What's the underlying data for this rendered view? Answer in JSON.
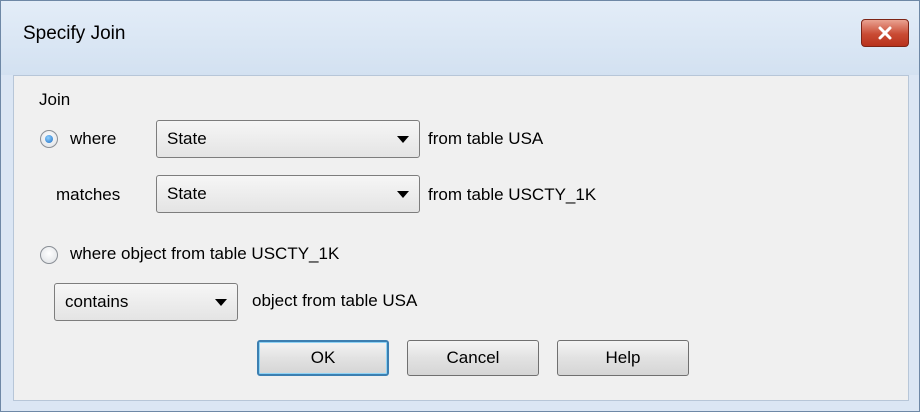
{
  "dialog": {
    "title": "Specify Join",
    "close_icon": "close-icon",
    "accent_close": "#c94a33"
  },
  "join": {
    "group_label": "Join",
    "option1": {
      "selected": true,
      "where_label": "where",
      "where_field": "State",
      "where_suffix": "from table USA",
      "matches_label": "matches",
      "matches_field": "State",
      "matches_suffix": "from table USCTY_1K"
    },
    "option2": {
      "selected": false,
      "label": "where object from table USCTY_1K",
      "operator": "contains",
      "operator_suffix": "object from table USA"
    }
  },
  "buttons": {
    "ok": "OK",
    "cancel": "Cancel",
    "help": "Help"
  }
}
